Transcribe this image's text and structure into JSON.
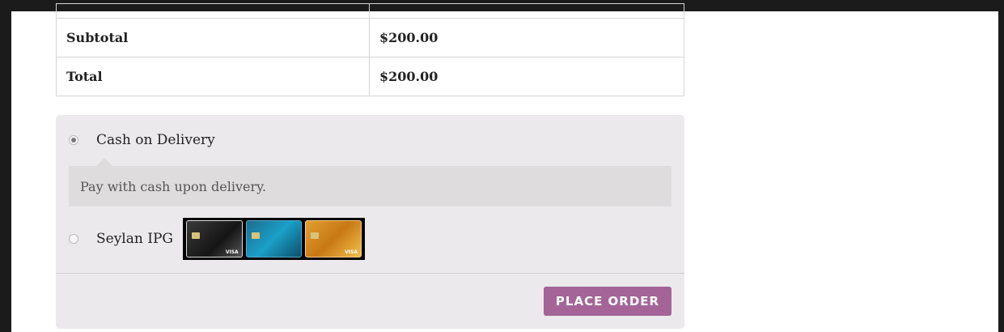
{
  "totals": {
    "rows": [
      {
        "label": "Subtotal",
        "value": "$200.00"
      },
      {
        "label": "Total",
        "value": "$200.00"
      }
    ]
  },
  "payment": {
    "methods": [
      {
        "label": "Cash on Delivery",
        "selected": true,
        "description": "Pay with cash upon delivery."
      },
      {
        "label": "Seylan IPG",
        "selected": false
      }
    ],
    "card_icons": [
      "card-dark-icon",
      "card-blue-icon",
      "card-gold-icon"
    ],
    "place_order_label": "PLACE ORDER",
    "accent_color": "#a46497"
  }
}
